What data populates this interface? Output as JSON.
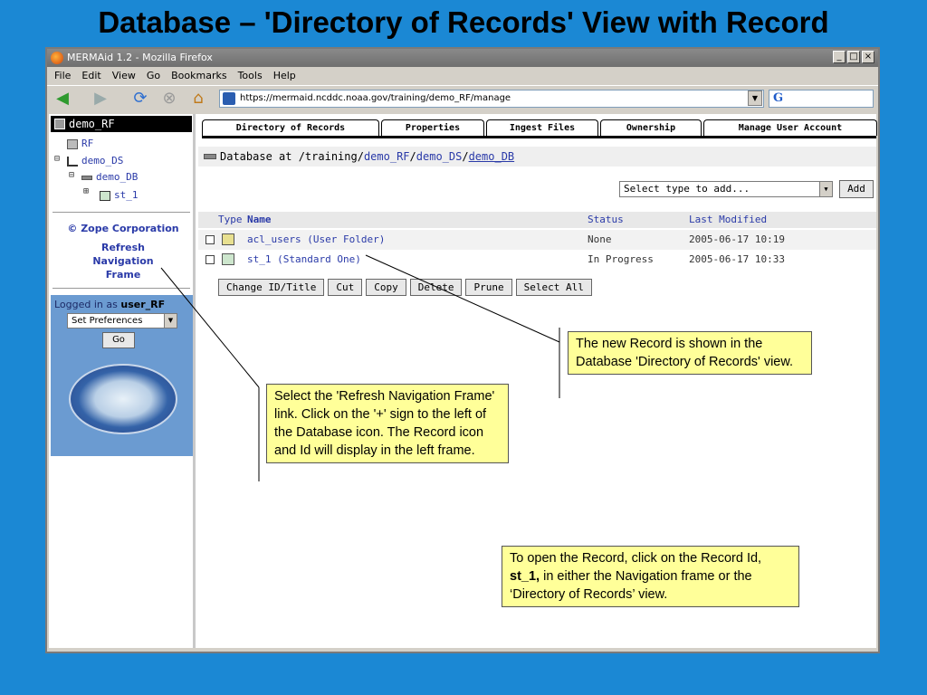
{
  "slide_title": "Database – 'Directory of Records' View with Record",
  "window": {
    "title": "MERMAid 1.2 - Mozilla Firefox",
    "controls": [
      "_",
      "□",
      "×"
    ]
  },
  "menu": [
    "File",
    "Edit",
    "View",
    "Go",
    "Bookmarks",
    "Tools",
    "Help"
  ],
  "toolbar": {
    "url": "https://mermaid.ncddc.noaa.gov/training/demo_RF/manage",
    "search_icon_text": "G"
  },
  "nav": {
    "root": "demo_RF",
    "items": [
      {
        "label": "RF"
      },
      {
        "label": "demo_DS"
      },
      {
        "label": "demo_DB"
      },
      {
        "label": "st_1"
      }
    ],
    "plus_symbol": "⊟",
    "expand_symbol": "⊞",
    "zope": "© Zope Corporation",
    "refresh_line1": "Refresh",
    "refresh_line2": "Navigation",
    "refresh_line3": "Frame",
    "logged_prefix": "Logged in as ",
    "logged_user": "user_RF",
    "pref_select": "Set Preferences",
    "go": "Go"
  },
  "tabs": [
    {
      "label": "Directory of Records"
    },
    {
      "label": "Properties"
    },
    {
      "label": "Ingest Files"
    },
    {
      "label": "Ownership"
    },
    {
      "label": "Manage User Account"
    }
  ],
  "path": {
    "prefix": "Database at  /training/",
    "seg1": "demo_RF",
    "sep1": "/",
    "seg2": "demo_DS",
    "sep2": "/",
    "seg3": "demo_DB"
  },
  "add_select": "Select type to add...",
  "add_button": "Add",
  "table": {
    "headers": {
      "type": "Type",
      "name": "Name",
      "status": "Status",
      "modified": "Last Modified"
    },
    "rows": [
      {
        "name": "acl_users (User Folder)",
        "status": "None",
        "modified": "2005-06-17 10:19"
      },
      {
        "name": "st_1 (Standard One)",
        "status": "In Progress",
        "modified": "2005-06-17 10:33"
      }
    ]
  },
  "actions": [
    "Change ID/Title",
    "Cut",
    "Copy",
    "Delete",
    "Prune",
    "Select All"
  ],
  "callouts": {
    "new_record": "The new Record is shown in the Database 'Directory of Records' view.",
    "refresh": "Select the 'Refresh Navigation Frame' link. Click on the '+' sign to the left of the Database icon. The Record icon and Id will display in the left frame.",
    "open_pre": "To open the Record, click on the Record Id, ",
    "open_bold": "st_1,",
    "open_post": " in either the Navigation frame or the ‘Directory of Records’ view."
  },
  "colors": {
    "slide_bg": "#1b88d4",
    "callout_bg": "#ffff99",
    "link": "#2a3aa8",
    "login_panel": "#6b9bd1"
  }
}
